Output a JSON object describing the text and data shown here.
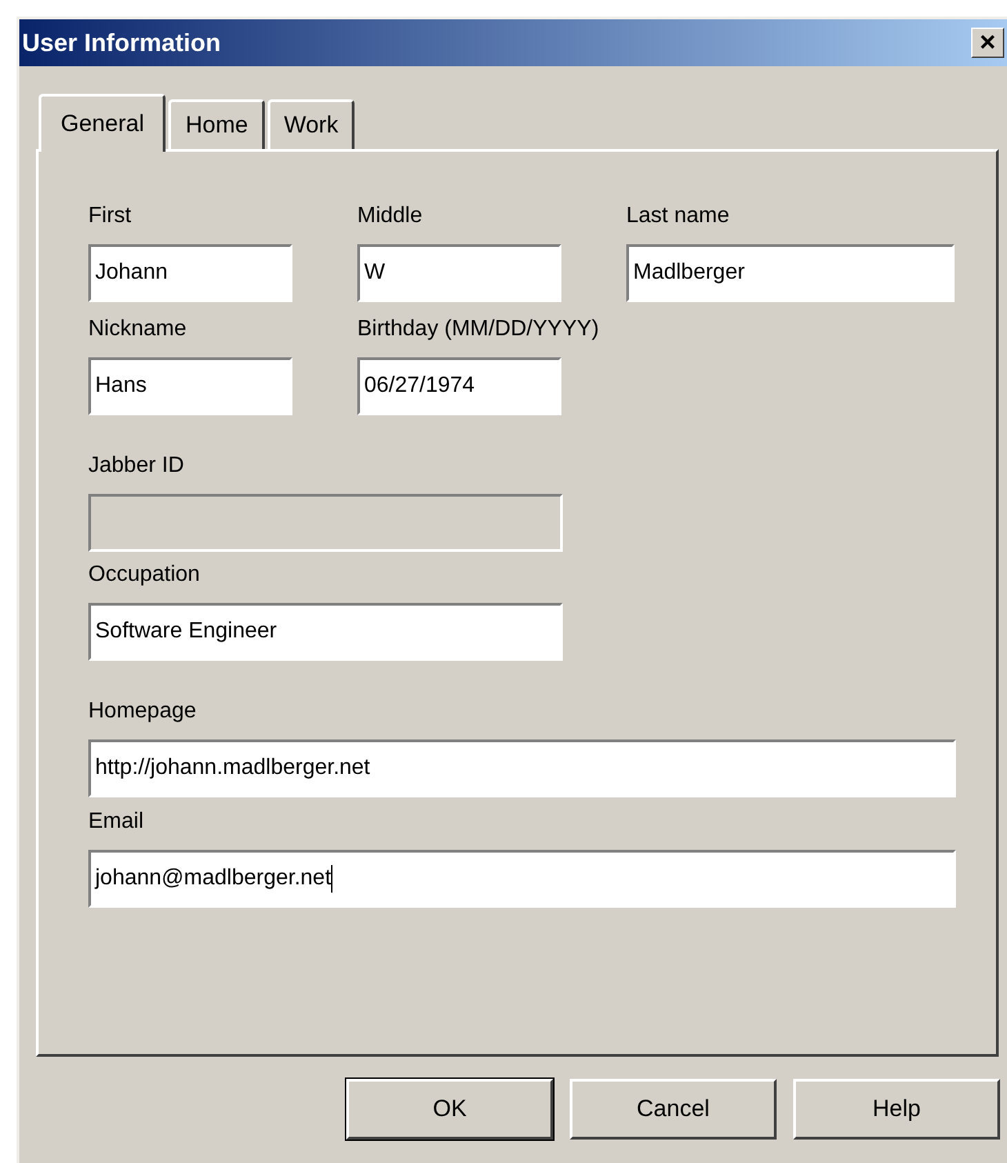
{
  "window": {
    "title": "User Information",
    "close": "×"
  },
  "tabs": [
    {
      "label": "General",
      "selected": true
    },
    {
      "label": "Home",
      "selected": false
    },
    {
      "label": "Work",
      "selected": false
    }
  ],
  "rows": [
    [
      {
        "label": "First",
        "value": "Johann",
        "disabled": false,
        "focused": false
      },
      {
        "label": "Middle",
        "value": "W",
        "disabled": false,
        "focused": false
      },
      {
        "label": "Last name",
        "value": "Madlberger",
        "disabled": false,
        "focused": false
      }
    ],
    [
      {
        "label": "Nickname",
        "value": "Hans",
        "disabled": false,
        "focused": false
      },
      {
        "label": "Birthday (MM/DD/YYYY)",
        "value": "06/27/1974",
        "disabled": false,
        "focused": false
      }
    ],
    [
      {
        "label": "Jabber ID",
        "disabled": true,
        "focused": false
      }
    ],
    [
      {
        "label": "Occupation",
        "value": "Software Engineer",
        "disabled": false,
        "focused": false
      }
    ],
    [
      {
        "label": "Homepage",
        "value": "http://johann.madlberger.net",
        "disabled": false,
        "focused": false
      }
    ],
    [
      {
        "label": "Email",
        "value": "johann@madlberger.net",
        "disabled": false,
        "focused": true
      }
    ]
  ],
  "buttons": [
    {
      "label": "OK",
      "default": true
    },
    {
      "label": "Cancel",
      "default": false
    },
    {
      "label": "Help",
      "default": false
    }
  ]
}
